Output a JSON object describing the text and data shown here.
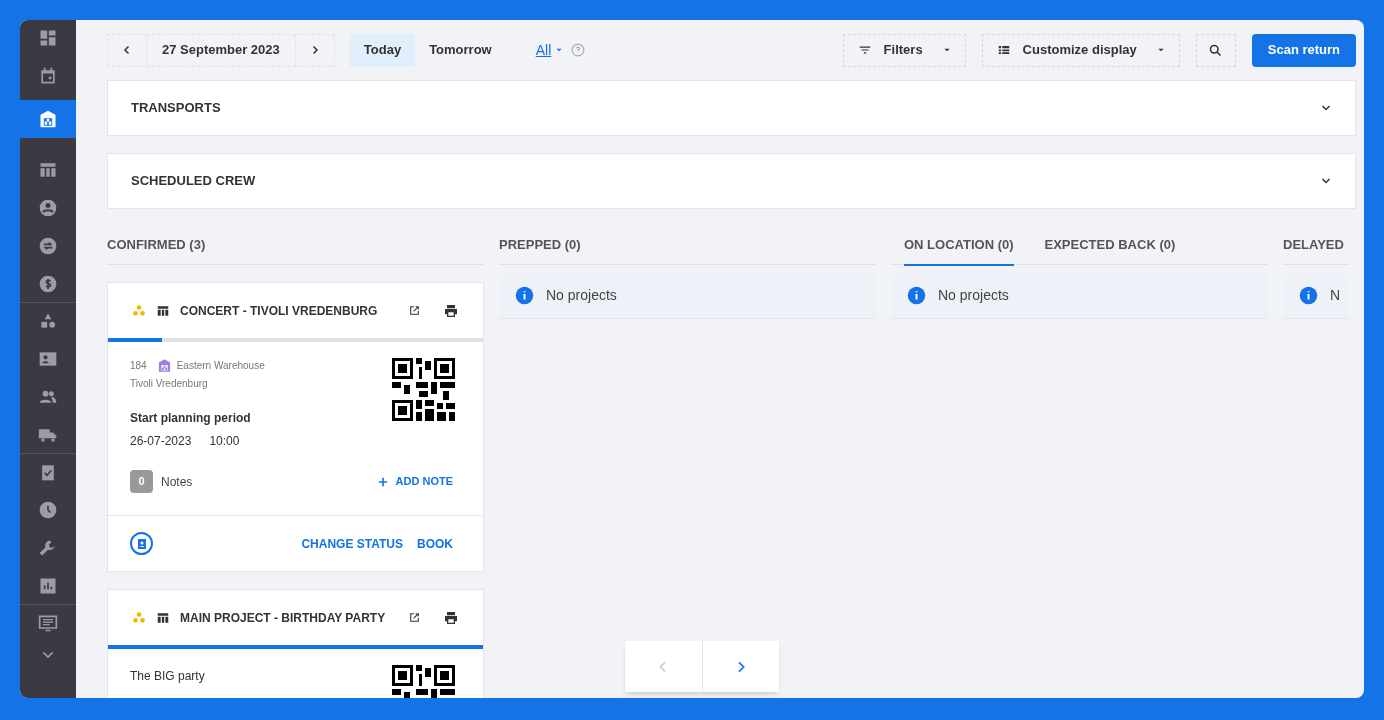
{
  "sidebar": {
    "groups": [
      {
        "items": [
          {
            "selected": false
          },
          {
            "selected": false
          },
          {
            "selected": true
          }
        ]
      },
      {
        "items": [
          {
            "selected": false
          },
          {
            "selected": false
          },
          {
            "selected": false
          },
          {
            "selected": false
          }
        ]
      },
      {
        "items": [
          {
            "selected": false
          },
          {
            "selected": false
          },
          {
            "selected": false
          },
          {
            "selected": false
          }
        ]
      },
      {
        "items": [
          {
            "selected": false
          },
          {
            "selected": false
          },
          {
            "selected": false
          },
          {
            "selected": false
          }
        ]
      },
      {
        "items": [
          {
            "selected": false
          }
        ]
      }
    ]
  },
  "toolbar": {
    "date": "27 September 2023",
    "day_tabs": [
      {
        "label": "Today",
        "selected": true
      },
      {
        "label": "Tomorrow",
        "selected": false
      }
    ],
    "scope": "All",
    "filters": "Filters",
    "customize": "Customize display",
    "scan": "Scan return"
  },
  "panels": [
    {
      "title": "TRANSPORTS",
      "expanded": false
    },
    {
      "title": "SCHEDULED CREW",
      "expanded": false
    }
  ],
  "columns": [
    {
      "tabs": [
        {
          "label": "CONFIRMED (3)"
        }
      ],
      "cards": [
        {
          "title": "CONCERT - TIVOLI VREDENBURG",
          "level": 0.145,
          "number": "184",
          "warehouse": "Eastern Warehouse",
          "location": "Tivoli Vredenburg",
          "period_label": "Start planning period",
          "date": "26-07-2023",
          "time": "10:00",
          "notes_count": "0",
          "notes_label": "Notes",
          "add_note": "ADD NOTE",
          "actions": [
            "CHANGE STATUS",
            "BOOK"
          ]
        },
        {
          "title": "MAIN PROJECT - BIRTHDAY PARTY",
          "level": 1,
          "subtitle": "The BIG party"
        }
      ]
    },
    {
      "tabs": [
        {
          "label": "PREPPED (0)"
        }
      ],
      "empty": "No projects"
    },
    {
      "tabs": [
        {
          "label": "ON LOCATION (0)",
          "selected": true
        },
        {
          "label": "EXPECTED BACK (0)",
          "selected": false
        }
      ],
      "empty": "No projects"
    },
    {
      "tabs": [
        {
          "label": "DELAYED"
        }
      ],
      "empty": "N"
    }
  ],
  "pager": {
    "prev_disabled": true,
    "next_disabled": false
  }
}
